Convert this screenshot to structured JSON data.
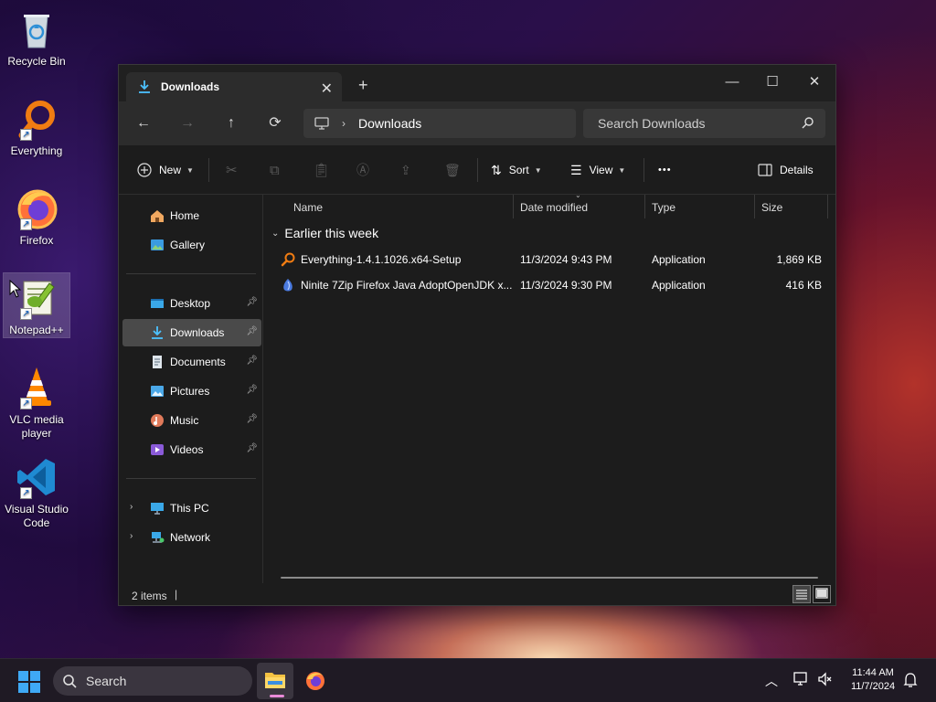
{
  "desktop": {
    "icons": [
      {
        "label": "Recycle Bin"
      },
      {
        "label": "Everything"
      },
      {
        "label": "Firefox"
      },
      {
        "label": "Notepad++"
      },
      {
        "label": "VLC media player"
      },
      {
        "label": "Visual Studio Code"
      }
    ]
  },
  "window": {
    "tab_title": "Downloads",
    "new_tab": "+",
    "controls": {
      "minimize": "—",
      "maximize": "☐",
      "close": "✕"
    },
    "address": {
      "crumb": "Downloads"
    },
    "search": {
      "placeholder": "Search Downloads"
    },
    "commands": {
      "new": "New",
      "sort": "Sort",
      "view": "View",
      "more": "•••",
      "details": "Details"
    },
    "nav": {
      "home": "Home",
      "gallery": "Gallery",
      "desktop": "Desktop",
      "downloads": "Downloads",
      "documents": "Documents",
      "pictures": "Pictures",
      "music": "Music",
      "videos": "Videos",
      "this_pc": "This PC",
      "network": "Network"
    },
    "columns": {
      "name": "Name",
      "date": "Date modified",
      "type": "Type",
      "size": "Size"
    },
    "group": "Earlier this week",
    "files": [
      {
        "name": "Everything-1.4.1.1026.x64-Setup",
        "date": "11/3/2024 9:43 PM",
        "type": "Application",
        "size": "1,869 KB"
      },
      {
        "name": "Ninite 7Zip Firefox Java AdoptOpenJDK x...",
        "date": "11/3/2024 9:30 PM",
        "type": "Application",
        "size": "416 KB"
      }
    ],
    "status": {
      "items": "2 items"
    }
  },
  "taskbar": {
    "search_label": "Search",
    "time": "11:44 AM",
    "date": "11/7/2024"
  },
  "colors": {
    "accent": "#4cc2ff",
    "window_bg": "#1c1c1c",
    "selected_nav": "#4a4a4a"
  }
}
